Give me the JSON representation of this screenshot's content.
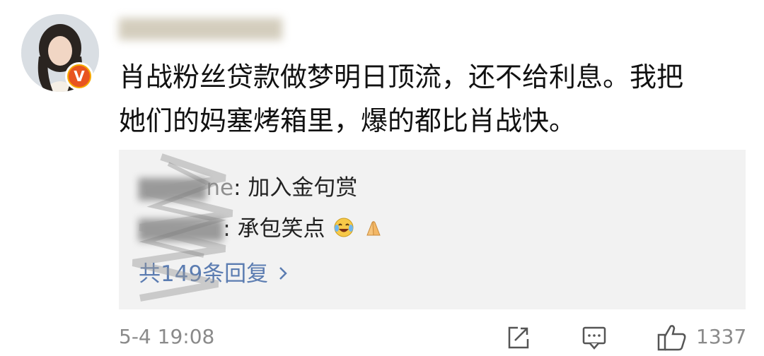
{
  "comment": {
    "author_badge": "V",
    "text_line1": "肖战粉丝贷款做梦明日顶流，还不给利息。我把",
    "text_line2": "她们的妈塞烤箱里，爆的都比肖战快。"
  },
  "replies": [
    {
      "name": "ne",
      "text": ": 加入金句赏"
    },
    {
      "name": "",
      "text": ": 承包笑点",
      "emojis": [
        "laughing-crying-emoji",
        "prayer-hands-emoji"
      ]
    }
  ],
  "more_replies": "共149条回复",
  "footer": {
    "time": "5-4 19:08",
    "like_count": "1337"
  },
  "colors": {
    "reply_bg": "#f2f2f2",
    "link": "#5b7cb1",
    "meta_gray": "#8a8a8a",
    "badge_orange": "#f6a800"
  }
}
